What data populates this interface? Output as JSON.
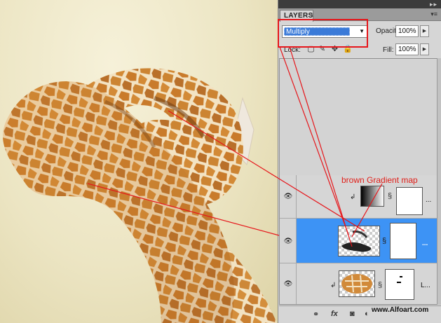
{
  "panel": {
    "tab_label": "LAYERS",
    "tab_close": "x",
    "collapse_icon": "▸▸",
    "menu_icon": "▾≡",
    "blend_mode": "Multiply",
    "opacity_label": "Opacity:",
    "opacity_value": "100%",
    "lock_label": "Lock:",
    "fill_label": "Fill:",
    "fill_value": "100%"
  },
  "layers": [
    {
      "name": "...",
      "kind": "gradient-map-adjustment",
      "visible": true,
      "selected": false
    },
    {
      "name": "...",
      "kind": "pixel-layer-with-mask",
      "visible": true,
      "selected": true
    },
    {
      "name": "L...",
      "kind": "giraffe-texture-layer",
      "visible": true,
      "selected": false
    }
  ],
  "annotation": "brown Gradient map",
  "watermark": "www.Alfoart.com",
  "icons": [
    "eye-icon",
    "link-icon",
    "fx-icon",
    "mask-icon",
    "adjustment-icon",
    "folder-icon",
    "new-layer-icon",
    "trash-icon"
  ],
  "colors": {
    "selection_blue": "#3d93f5",
    "annotation_red": "#e0201a",
    "blend_field_blue": "#3a7ad8"
  }
}
